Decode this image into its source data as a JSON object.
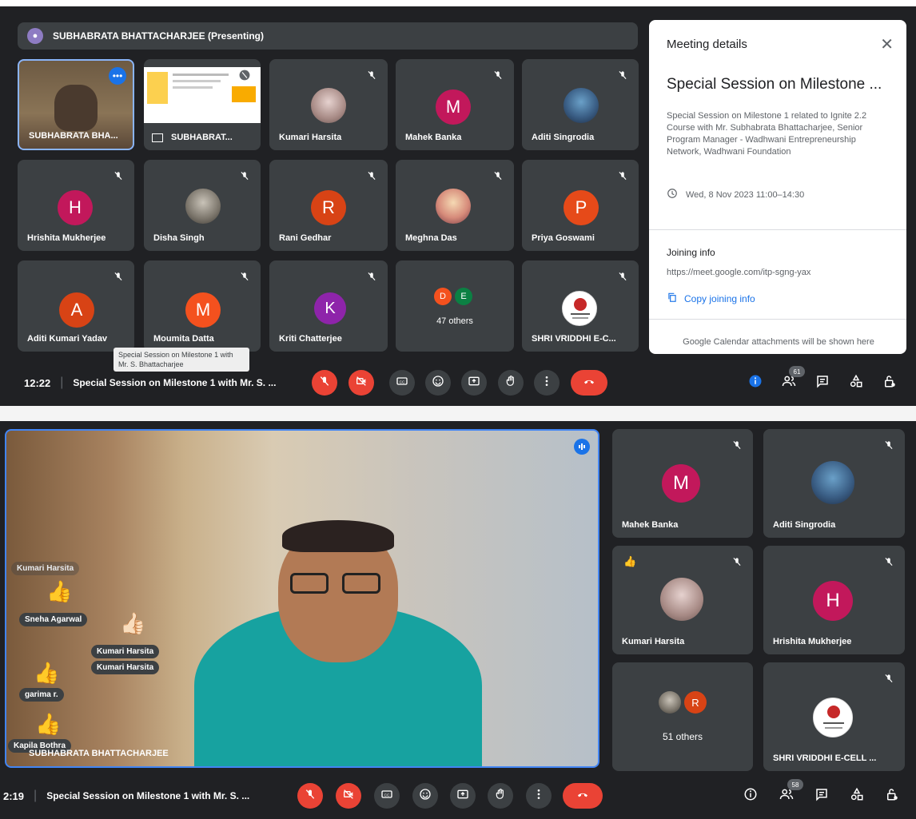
{
  "top": {
    "presenting_label": "SUBHABRATA BHATTACHARJEE (Presenting)",
    "tiles": [
      {
        "name": "SUBHABRATA BHA..."
      },
      {
        "name": "SUBHABRAT..."
      },
      {
        "name": "Kumari Harsita"
      },
      {
        "name": "Mahek Banka",
        "initial": "M",
        "color": "#c2185b"
      },
      {
        "name": "Aditi Singrodia"
      },
      {
        "name": "Hrishita Mukherjee",
        "initial": "H",
        "color": "#c2185b"
      },
      {
        "name": "Disha Singh"
      },
      {
        "name": "Rani Gedhar",
        "initial": "R",
        "color": "#d84315"
      },
      {
        "name": "Meghna Das"
      },
      {
        "name": "Priya Goswami",
        "initial": "P",
        "color": "#e64a19"
      },
      {
        "name": "Aditi Kumari Yadav",
        "initial": "A",
        "color": "#d84315"
      },
      {
        "name": "Moumita Datta",
        "initial": "M",
        "color": "#f4511e"
      },
      {
        "name": "Kriti Chatterjee",
        "initial": "K",
        "color": "#8e24aa"
      },
      {
        "name": "47 others",
        "initials": [
          "D",
          "E"
        ],
        "colors": [
          "#f4511e",
          "#0b8043"
        ]
      },
      {
        "name": "SHRI VRIDDHI E-C..."
      }
    ],
    "tooltip": "Special Session on Milestone 1 with Mr. S. Bhattacharjee",
    "details": {
      "header": "Meeting details",
      "title": "Special Session on Milestone ...",
      "description": "Special Session on Milestone 1 related to Ignite 2.2 Course with Mr. Subhabrata Bhattacharjee, Senior Program Manager - Wadhwani Entrepreneurship Network, Wadhwani Foundation",
      "datetime": "Wed, 8 Nov 2023 11:00–14:30",
      "joining_label": "Joining info",
      "link": "https://meet.google.com/itp-sgng-yax",
      "copy_label": "Copy joining info",
      "calendar_note": "Google Calendar attachments will be shown here"
    },
    "bar": {
      "time": "12:22",
      "title": "Special Session on Milestone 1 with Mr. S. ...",
      "participants_count": "61"
    }
  },
  "bottom": {
    "main_speaker": "SUBHABRATA BHATTACHARJEE",
    "reactions": [
      {
        "name": "Kumari Harsita"
      },
      {
        "name": "Sneha Agarwal"
      },
      {
        "name": "Kumari Harsita"
      },
      {
        "name": "Kumari Harsita"
      },
      {
        "name": "garima r."
      },
      {
        "name": "Kapila Bothra"
      }
    ],
    "tiles": [
      {
        "name": "Mahek Banka",
        "initial": "M",
        "color": "#c2185b"
      },
      {
        "name": "Aditi Singrodia"
      },
      {
        "name": "Kumari Harsita"
      },
      {
        "name": "Hrishita Mukherjee",
        "initial": "H",
        "color": "#c2185b"
      },
      {
        "name": "51 others",
        "initial": "R",
        "color": "#d84315"
      },
      {
        "name": "SHRI VRIDDHI E-CELL ..."
      }
    ],
    "bar": {
      "time": "2:19",
      "title": "Special Session on Milestone 1 with Mr. S. ...",
      "participants_count": "58"
    }
  },
  "icons": [
    "mic-off-icon",
    "camera-off-icon",
    "captions-icon",
    "emoji-icon",
    "present-icon",
    "raise-hand-icon",
    "more-icon",
    "end-call-icon",
    "info-icon",
    "people-icon",
    "chat-icon",
    "activities-icon",
    "host-controls-icon",
    "close-icon",
    "clock-icon",
    "copy-icon"
  ]
}
